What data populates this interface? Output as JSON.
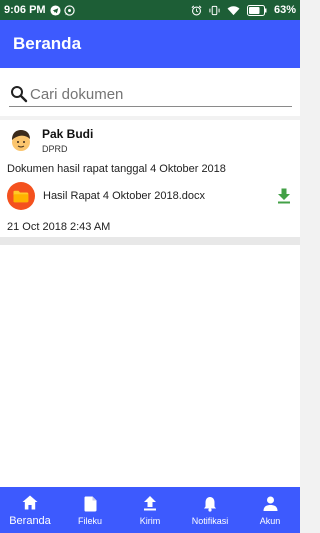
{
  "status_bar": {
    "time": "9:06 PM",
    "battery_percent": "63%"
  },
  "app_bar": {
    "title": "Beranda"
  },
  "search": {
    "placeholder": "Cari dokumen"
  },
  "feed": {
    "posts": [
      {
        "author": "Pak Budi",
        "role": "DPRD",
        "description": "Dokumen hasil rapat tanggal 4 Oktober 2018",
        "file_name": "Hasil Rapat 4 Oktober 2018.docx",
        "timestamp": "21 Oct 2018 2:43 AM"
      }
    ]
  },
  "bottom_nav": {
    "items": [
      {
        "label": "Beranda",
        "icon": "home-icon",
        "active": true
      },
      {
        "label": "Fileku",
        "icon": "file-icon",
        "active": false
      },
      {
        "label": "Kirim",
        "icon": "upload-icon",
        "active": false
      },
      {
        "label": "Notifikasi",
        "icon": "bell-icon",
        "active": false
      },
      {
        "label": "Akun",
        "icon": "person-icon",
        "active": false
      }
    ]
  },
  "colors": {
    "status_bar": "#1d5e36",
    "primary": "#3d5afe",
    "folder_badge": "#f4511e",
    "download_icon": "#43a047"
  }
}
